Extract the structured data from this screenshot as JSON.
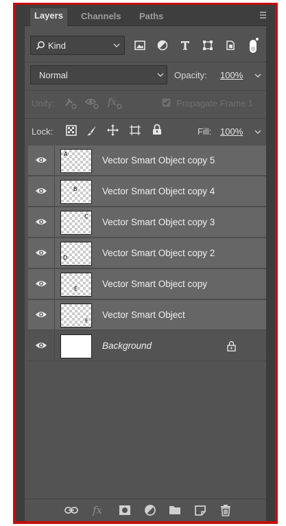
{
  "tabs": [
    {
      "label": "Layers"
    },
    {
      "label": "Channels"
    },
    {
      "label": "Paths"
    }
  ],
  "filter": {
    "kind_label": "Kind"
  },
  "blend": {
    "mode": "Normal",
    "opacity_label": "Opacity:",
    "opacity_value": "100%"
  },
  "unify": {
    "label": "Unify:",
    "propagate_label": "Propagate Frame 1"
  },
  "lock": {
    "label": "Lock:",
    "fill_label": "Fill:",
    "fill_value": "100%"
  },
  "layers": [
    {
      "name": "Vector Smart Object copy 5",
      "thumb_letter": "A"
    },
    {
      "name": "Vector Smart Object copy 4",
      "thumb_letter": "B"
    },
    {
      "name": "Vector Smart Object copy 3",
      "thumb_letter": "C"
    },
    {
      "name": "Vector Smart Object copy 2",
      "thumb_letter": "D"
    },
    {
      "name": "Vector Smart Object copy",
      "thumb_letter": "E"
    },
    {
      "name": "Vector Smart Object",
      "thumb_letter": "F"
    },
    {
      "name": "Background",
      "thumb_letter": ""
    }
  ],
  "colors": {
    "highlight_border": "#c70d0d",
    "panel_bg": "#535353",
    "layer_bg": "#666666"
  }
}
